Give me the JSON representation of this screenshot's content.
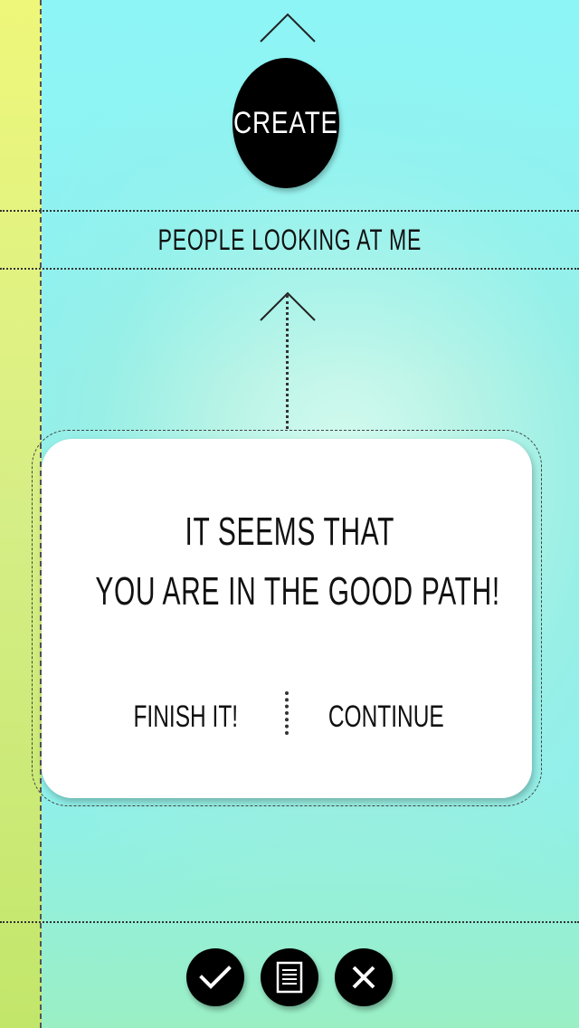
{
  "header": {
    "create_label": "CREATE",
    "section_label": "PEOPLE LOOKING AT ME"
  },
  "dialog": {
    "message_line1": "IT SEEMS THAT",
    "message_line2": "YOU ARE IN THE GOOD PATH!",
    "finish_label": "FINISH IT!",
    "continue_label": "CONTINUE"
  },
  "toolbar": {
    "buttons": [
      "check-icon",
      "document-icon",
      "close-icon"
    ]
  },
  "colors": {
    "strip_top": "#eef77a",
    "strip_bottom": "#c2e66a",
    "background": "#8ef0ee",
    "button": "#000000"
  }
}
